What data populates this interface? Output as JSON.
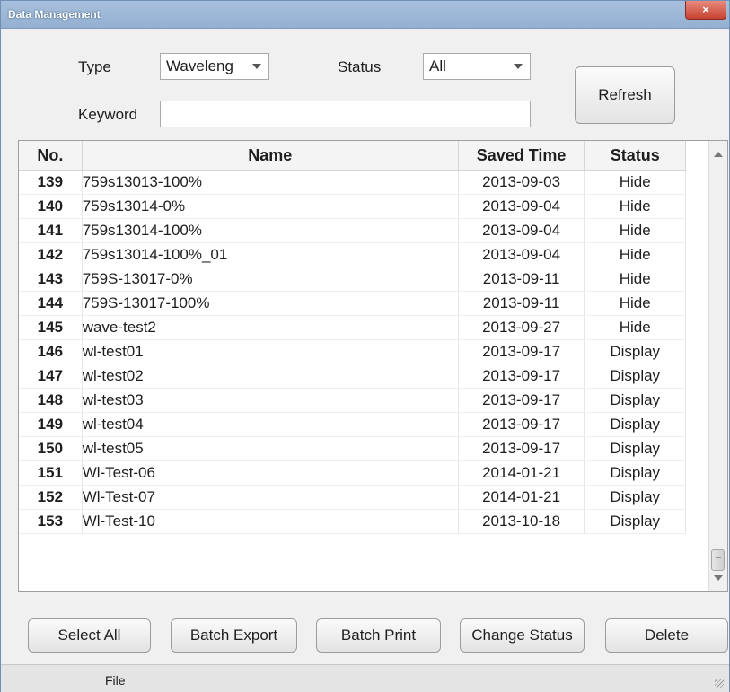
{
  "window": {
    "title": "Data Management",
    "close_label": "×"
  },
  "filters": {
    "type_label": "Type",
    "type_value": "Waveleng",
    "status_label": "Status",
    "status_value": "All",
    "keyword_label": "Keyword",
    "keyword_value": "",
    "refresh_label": "Refresh"
  },
  "table": {
    "headers": {
      "no": "No.",
      "name": "Name",
      "saved_time": "Saved Time",
      "status": "Status"
    },
    "rows": [
      {
        "no": "139",
        "name": "759s13013-100%",
        "saved_time": "2013-09-03",
        "status": "Hide"
      },
      {
        "no": "140",
        "name": "759s13014-0%",
        "saved_time": "2013-09-04",
        "status": "Hide"
      },
      {
        "no": "141",
        "name": "759s13014-100%",
        "saved_time": "2013-09-04",
        "status": "Hide"
      },
      {
        "no": "142",
        "name": "759s13014-100%_01",
        "saved_time": "2013-09-04",
        "status": "Hide"
      },
      {
        "no": "143",
        "name": "759S-13017-0%",
        "saved_time": "2013-09-11",
        "status": "Hide"
      },
      {
        "no": "144",
        "name": "759S-13017-100%",
        "saved_time": "2013-09-11",
        "status": "Hide"
      },
      {
        "no": "145",
        "name": "wave-test2",
        "saved_time": "2013-09-27",
        "status": "Hide"
      },
      {
        "no": "146",
        "name": "wl-test01",
        "saved_time": "2013-09-17",
        "status": "Display"
      },
      {
        "no": "147",
        "name": "wl-test02",
        "saved_time": "2013-09-17",
        "status": "Display"
      },
      {
        "no": "148",
        "name": "wl-test03",
        "saved_time": "2013-09-17",
        "status": "Display"
      },
      {
        "no": "149",
        "name": "wl-test04",
        "saved_time": "2013-09-17",
        "status": "Display"
      },
      {
        "no": "150",
        "name": "wl-test05",
        "saved_time": "2013-09-17",
        "status": "Display"
      },
      {
        "no": "151",
        "name": "Wl-Test-06",
        "saved_time": "2014-01-21",
        "status": "Display"
      },
      {
        "no": "152",
        "name": "Wl-Test-07",
        "saved_time": "2014-01-21",
        "status": "Display"
      },
      {
        "no": "153",
        "name": "Wl-Test-10",
        "saved_time": "2013-10-18",
        "status": "Display"
      }
    ]
  },
  "actions": {
    "select_all": "Select All",
    "batch_export": "Batch Export",
    "batch_print": "Batch Print",
    "change_status": "Change Status",
    "delete": "Delete"
  },
  "statusbar": {
    "file_label": "File"
  },
  "colors": {
    "titlebar": "#a7c0dd",
    "close_button": "#c74332",
    "window_bg": "#f0f0f0"
  }
}
